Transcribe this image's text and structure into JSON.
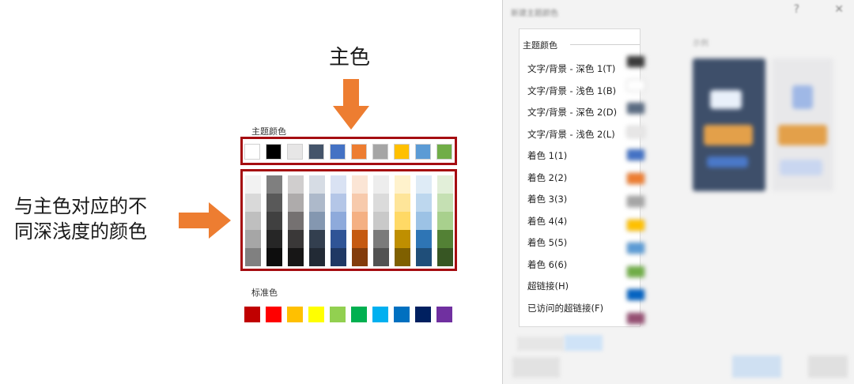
{
  "annotations": {
    "main_color": "主色",
    "tone_label_line1": "与主色对应的不",
    "tone_label_line2": "同深浅度的颜色",
    "accent_color": "#ed7d31",
    "highlight_color": "#a50d11"
  },
  "palette": {
    "theme_title": "主题颜色",
    "standard_title": "标准色",
    "theme_colors": [
      "#ffffff",
      "#000000",
      "#e7e6e6",
      "#44546a",
      "#4472c4",
      "#ed7d31",
      "#a5a5a5",
      "#ffc000",
      "#5b9bd5",
      "#70ad47"
    ],
    "shades": [
      [
        "#f2f2f2",
        "#d9d9d9",
        "#bfbfbf",
        "#a6a6a6",
        "#808080"
      ],
      [
        "#7f7f7f",
        "#595959",
        "#404040",
        "#262626",
        "#0d0d0d"
      ],
      [
        "#d0cece",
        "#aeabab",
        "#757171",
        "#3a3838",
        "#171616"
      ],
      [
        "#d6dce4",
        "#adb9ca",
        "#8497b0",
        "#333f4f",
        "#222a35"
      ],
      [
        "#d9e2f3",
        "#b4c6e7",
        "#8eaadb",
        "#2f5496",
        "#1f3864"
      ],
      [
        "#fbe5d5",
        "#f7caac",
        "#f4b083",
        "#c55a11",
        "#833c0b"
      ],
      [
        "#ededed",
        "#dbdbdb",
        "#c9c9c9",
        "#7b7b7b",
        "#525252"
      ],
      [
        "#fff2cc",
        "#fee599",
        "#ffd965",
        "#bf8f00",
        "#7f6000"
      ],
      [
        "#deebf6",
        "#bdd7ee",
        "#9cc2e5",
        "#2e75b5",
        "#1f4e79"
      ],
      [
        "#e2efd9",
        "#c5e0b3",
        "#a8d08d",
        "#538135",
        "#375623"
      ]
    ],
    "standard_colors": [
      "#c00000",
      "#ff0000",
      "#ffc000",
      "#ffff00",
      "#92d050",
      "#00b050",
      "#00b0f0",
      "#0070c0",
      "#002060",
      "#7030a0"
    ]
  },
  "dialog": {
    "title": "新建主题颜色",
    "section_title": "主题颜色",
    "preview_label": "示例",
    "items": [
      "文字/背景 - 深色 1(T)",
      "文字/背景 - 浅色 1(B)",
      "文字/背景 - 深色 2(D)",
      "文字/背景 - 浅色 2(L)",
      "着色 1(1)",
      "着色 2(2)",
      "着色 3(3)",
      "着色 4(4)",
      "着色 5(5)",
      "着色 6(6)",
      "超链接(H)",
      "已访问的超链接(F)"
    ],
    "item_swatches": [
      "#3a3a3a",
      "#ffffff",
      "#5a6b82",
      "#e7e6e6",
      "#4472c4",
      "#ed7d31",
      "#a5a5a5",
      "#ffc000",
      "#5b9bd5",
      "#70ad47",
      "#0563c1",
      "#954f72"
    ]
  }
}
